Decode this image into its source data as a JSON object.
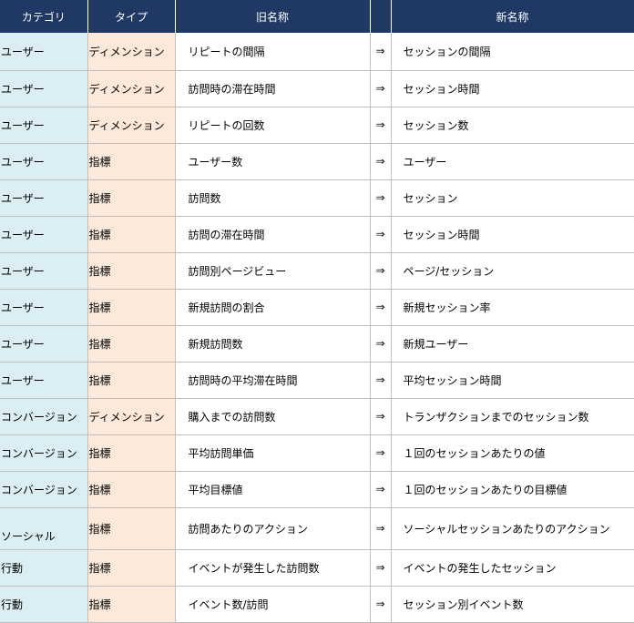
{
  "headers": {
    "category": "カテゴリ",
    "type": "タイプ",
    "old_name": "旧名称",
    "arrow": "",
    "new_name": "新名称"
  },
  "rows": [
    {
      "category": "ユーザー",
      "type": "ディメンション",
      "old": "リピートの間隔",
      "arrow": "⇒",
      "new": "セッションの間隔"
    },
    {
      "category": "ユーザー",
      "type": "ディメンション",
      "old": "訪問時の滞在時間",
      "arrow": "⇒",
      "new": "セッション時間"
    },
    {
      "category": "ユーザー",
      "type": "ディメンション",
      "old": "リピートの回数",
      "arrow": "⇒",
      "new": "セッション数"
    },
    {
      "category": "ユーザー",
      "type": "指標",
      "old": "ユーザー数",
      "arrow": "⇒",
      "new": "ユーザー"
    },
    {
      "category": "ユーザー",
      "type": "指標",
      "old": "訪問数",
      "arrow": "⇒",
      "new": "セッション"
    },
    {
      "category": "ユーザー",
      "type": "指標",
      "old": "訪問の滞在時間",
      "arrow": "⇒",
      "new": "セッション時間"
    },
    {
      "category": "ユーザー",
      "type": "指標",
      "old": "訪問別ページビュー",
      "arrow": "⇒",
      "new": "ページ/セッション"
    },
    {
      "category": "ユーザー",
      "type": "指標",
      "old": "新規訪問の割合",
      "arrow": "⇒",
      "new": "新規セッション率"
    },
    {
      "category": "ユーザー",
      "type": "指標",
      "old": "新規訪問数",
      "arrow": "⇒",
      "new": "新規ユーザー"
    },
    {
      "category": "ユーザー",
      "type": "指標",
      "old": "訪問時の平均滞在時間",
      "arrow": "⇒",
      "new": "平均セッション時間"
    },
    {
      "category": "コンバージョン",
      "type": "ディメンション",
      "old": "購入までの訪問数",
      "arrow": "⇒",
      "new": "トランザクションまでのセッション数"
    },
    {
      "category": "コンバージョン",
      "type": "指標",
      "old": "平均訪問単価",
      "arrow": "⇒",
      "new": "１回のセッションあたりの値"
    },
    {
      "category": "コンバージョン",
      "type": "指標",
      "old": "平均目標値",
      "arrow": "⇒",
      "new": "１回のセッションあたりの目標値"
    },
    {
      "category": "ソーシャル",
      "type": "指標",
      "old": "訪問あたりのアクション",
      "arrow": "⇒",
      "new": "ソーシャルセッションあたりのアクション"
    },
    {
      "category": "行動",
      "type": "指標",
      "old": "イベントが発生した訪問数",
      "arrow": "⇒",
      "new": "イベントの発生したセッション"
    },
    {
      "category": "行動",
      "type": "指標",
      "old": "イベント数/訪問",
      "arrow": "⇒",
      "new": "セッション別イベント数"
    }
  ]
}
